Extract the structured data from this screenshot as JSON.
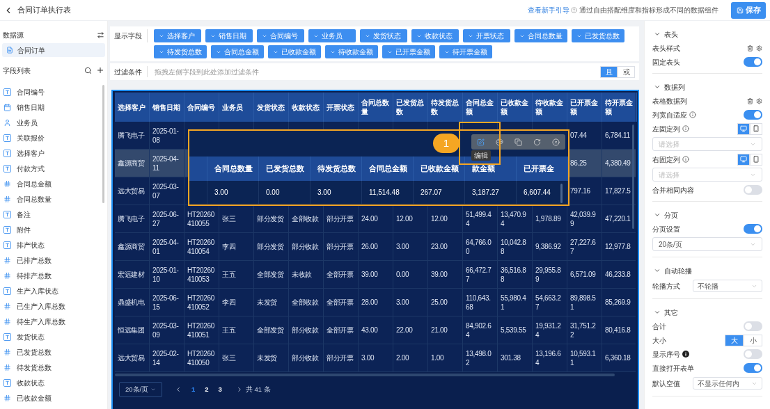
{
  "header": {
    "title": "合同订单执行表",
    "guide_link": "查看新手引导",
    "description": "通过自由搭配维度和指标形成不同的数据组件",
    "save_button": "保存"
  },
  "sidebar": {
    "datasource_title": "数据源",
    "datasources": [
      {
        "label": "合同订单",
        "selected": true
      }
    ],
    "fields_title": "字段列表",
    "fields": [
      {
        "label": "合同编号",
        "kind": "text"
      },
      {
        "label": "销售日期",
        "kind": "date"
      },
      {
        "label": "业务员",
        "kind": "user"
      },
      {
        "label": "关联报价",
        "kind": "text"
      },
      {
        "label": "选择客户",
        "kind": "text"
      },
      {
        "label": "付款方式",
        "kind": "text"
      },
      {
        "label": "合同总金额",
        "kind": "number"
      },
      {
        "label": "合同总数量",
        "kind": "number"
      },
      {
        "label": "备注",
        "kind": "text"
      },
      {
        "label": "附件",
        "kind": "text"
      },
      {
        "label": "排产状态",
        "kind": "text"
      },
      {
        "label": "已排产总数",
        "kind": "number"
      },
      {
        "label": "待排产总数",
        "kind": "number"
      },
      {
        "label": "生产入库状态",
        "kind": "text"
      },
      {
        "label": "已生产入库总数",
        "kind": "number"
      },
      {
        "label": "待生产入库总数",
        "kind": "number"
      },
      {
        "label": "发货状态",
        "kind": "text"
      },
      {
        "label": "已发货总数",
        "kind": "number"
      },
      {
        "label": "待发货总数",
        "kind": "number"
      },
      {
        "label": "收款状态",
        "kind": "text"
      },
      {
        "label": "已收款金额",
        "kind": "number"
      }
    ]
  },
  "display_fields": {
    "label": "显示字段",
    "chips": [
      "选择客户",
      "销售日期",
      "合同编号",
      "业务员",
      "发货状态",
      "收款状态",
      "开票状态",
      "合同总数量",
      "已发货总数",
      "待发货总数",
      "合同总金额",
      "已收款金额",
      "待收款金额",
      "已开票金额",
      "待开票金额"
    ]
  },
  "filter": {
    "label": "过滤条件",
    "placeholder": "拖拽左侧字段到此处添加过滤条件",
    "logic": [
      {
        "label": "且",
        "selected": true
      },
      {
        "label": "或",
        "selected": false
      }
    ]
  },
  "table": {
    "columns": [
      "选择客户",
      "销售日期",
      "合同编号",
      "业务员",
      "发货状态",
      "收款状态",
      "开票状态",
      "合同总数量",
      "已发货总数",
      "待发货总数",
      "合同总金额",
      "已收款金额",
      "待收款金额",
      "已开票金额",
      "待开票金额"
    ],
    "rows": [
      {
        "selected": false,
        "cells": [
          "腾飞电子",
          "2025-01-08",
          null,
          null,
          null,
          null,
          null,
          null,
          null,
          null,
          null,
          null,
          null,
          "07.44",
          "6,784.11"
        ]
      },
      {
        "selected": true,
        "cells": [
          "鑫源商贸",
          "2025-04-11",
          null,
          null,
          null,
          null,
          null,
          null,
          null,
          null,
          null,
          null,
          null,
          "86.25",
          "4,380.49"
        ]
      },
      {
        "selected": false,
        "cells": [
          "远大贸易",
          "2025-03-07",
          null,
          null,
          null,
          null,
          null,
          null,
          null,
          null,
          null,
          null,
          null,
          "797.16",
          "17,827.5"
        ]
      },
      {
        "selected": false,
        "cells": [
          "腾飞电子",
          "2025-06-27",
          "HT20260410055",
          "张三",
          "部分发货",
          "全部收款",
          "部分开票",
          "24.00",
          "12.00",
          "12.00",
          "51,499.44",
          "13,470.94",
          "1,978.89",
          "42,039.99",
          "47,220.1"
        ]
      },
      {
        "selected": false,
        "cells": [
          "鑫源商贸",
          "2025-04-01",
          "HT20260410054",
          "李四",
          "部分发货",
          "部分收款",
          "部分开票",
          "26.00",
          "3.00",
          "23.00",
          "64,766.00",
          "10,042.88",
          "9,386.92",
          "27,227.67",
          "12,977.8"
        ]
      },
      {
        "selected": false,
        "cells": [
          "宏远建材",
          "2025-01-10",
          "HT20260410053",
          "王五",
          "全部发货",
          "未收款",
          "全部开票",
          "39.00",
          "0.00",
          "39.00",
          "66,472.77",
          "36,516.88",
          "29,955.89",
          "6,571.09",
          "46,233.8"
        ]
      },
      {
        "selected": false,
        "cells": [
          "鼎盛机电",
          "2025-06-15",
          "HT20260410052",
          "李四",
          "未发货",
          "全部收款",
          "全部开票",
          "28.00",
          "3.00",
          "25.00",
          "110,643.68",
          "55,980.41",
          "54,663.27",
          "89,898.51",
          "85,269.9"
        ]
      },
      {
        "selected": false,
        "cells": [
          "恒远集团",
          "2025-03-09",
          "HT20260410051",
          "王五",
          "全部发货",
          "部分收款",
          "全部开票",
          "43.00",
          "22.00",
          "21.00",
          "84,902.64",
          "5,539.55",
          "19,931.24",
          "31,751.22",
          "80,416.8"
        ]
      },
      {
        "selected": false,
        "cells": [
          "远大贸易",
          "2025-02-14",
          "HT20260410050",
          "张三",
          "未发货",
          "部分收款",
          "部分开票",
          "3.00",
          "2.00",
          "1.00",
          "13,498.02",
          "301.38",
          "13,196.64",
          "10,593.11",
          "6,360.18"
        ]
      }
    ],
    "pagination": {
      "page_size": "20条/页",
      "pages": [
        {
          "label": "1",
          "selected": true
        },
        {
          "label": "2",
          "selected": false
        },
        {
          "label": "3",
          "selected": false
        }
      ],
      "total": "共 41 条"
    }
  },
  "overlay": {
    "badge": "1",
    "tooltip": "编辑",
    "columns": [
      "合同总数量",
      "已发货总数",
      "待发货总数",
      "合同总金额",
      "已收款金额",
      "款金额",
      "已开票金"
    ],
    "values": [
      "3.00",
      "0.00",
      "3.00",
      "11,514.48",
      "267.07",
      "3,187.27",
      "6,607.44"
    ]
  },
  "settings": {
    "sections": [
      {
        "title": "表头",
        "expanded": true,
        "items": [
          {
            "kind": "actions",
            "label": "表头样式"
          },
          {
            "kind": "switch",
            "label": "固定表头",
            "on": true
          }
        ]
      },
      {
        "title": "数据列",
        "expanded": true,
        "items": [
          {
            "kind": "actions",
            "label": "表格数据列"
          },
          {
            "kind": "switch",
            "label": "列宽自适应",
            "info": true,
            "info_filled": false,
            "on": true
          },
          {
            "kind": "devices",
            "label": "左固定列",
            "info": true,
            "info_filled": false,
            "devices": [
              {
                "kind": "desktop",
                "selected": true
              },
              {
                "kind": "phone",
                "selected": false
              }
            ]
          },
          {
            "kind": "select",
            "placeholder": "请选择"
          },
          {
            "kind": "devices",
            "label": "右固定列",
            "info": true,
            "info_filled": false,
            "devices": [
              {
                "kind": "desktop",
                "selected": true
              },
              {
                "kind": "phone",
                "selected": false
              }
            ]
          },
          {
            "kind": "select",
            "placeholder": "请选择"
          },
          {
            "kind": "switch",
            "label": "合并相同内容",
            "on": false
          }
        ]
      },
      {
        "title": "分页",
        "expanded": true,
        "items": [
          {
            "kind": "switch",
            "label": "分页设置",
            "on": true
          },
          {
            "kind": "select",
            "value": "20条/页"
          }
        ]
      },
      {
        "title": "自动轮播",
        "expanded": true,
        "items": [
          {
            "kind": "inline-select",
            "label": "轮播方式",
            "value": "不轮播"
          }
        ]
      },
      {
        "title": "其它",
        "expanded": true,
        "items": [
          {
            "kind": "switch",
            "label": "合计",
            "on": false
          },
          {
            "kind": "segmented",
            "label": "大小",
            "options": [
              {
                "label": "大",
                "selected": true
              },
              {
                "label": "小",
                "selected": false
              }
            ]
          },
          {
            "kind": "switch",
            "label": "显示序号",
            "info": true,
            "info_filled": true,
            "on": false
          },
          {
            "kind": "switch",
            "label": "直接打开表单",
            "on": true
          },
          {
            "kind": "inline-select",
            "label": "默认空值",
            "value": "不显示任何内"
          }
        ]
      }
    ]
  }
}
